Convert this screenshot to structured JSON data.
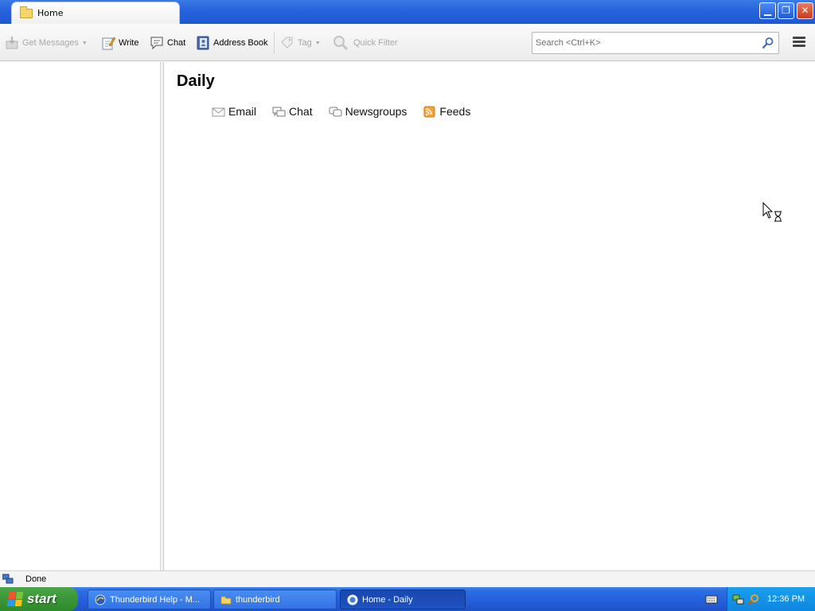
{
  "window": {
    "tab_title": "Home",
    "minimize": "▁",
    "maximize": "❐",
    "close": "✕"
  },
  "toolbar": {
    "get_messages": "Get Messages",
    "write": "Write",
    "chat": "Chat",
    "address_book": "Address Book",
    "tag": "Tag",
    "quick_filter": "Quick Filter",
    "search_placeholder": "Search <Ctrl+K>"
  },
  "content": {
    "account_title": "Daily",
    "setup_links": [
      {
        "label": "Email",
        "icon": "envelope-icon"
      },
      {
        "label": "Chat",
        "icon": "chat-bubbles-icon"
      },
      {
        "label": "Newsgroups",
        "icon": "newsgroups-icon"
      },
      {
        "label": "Feeds",
        "icon": "rss-feed-icon"
      }
    ]
  },
  "statusbar": {
    "text": "Done"
  },
  "taskbar": {
    "start_label": "start",
    "tasks": [
      {
        "label": "Thunderbird Help - M...",
        "active": false
      },
      {
        "label": "thunderbird",
        "active": false
      },
      {
        "label": "Home - Daily",
        "active": true
      }
    ],
    "clock": "12:36 PM"
  },
  "colors": {
    "title_blue": "#2563dc",
    "taskbar_blue": "#245edb",
    "start_green": "#3a9636",
    "feed_orange": "#f4a43a",
    "close_red": "#c83c1c"
  }
}
